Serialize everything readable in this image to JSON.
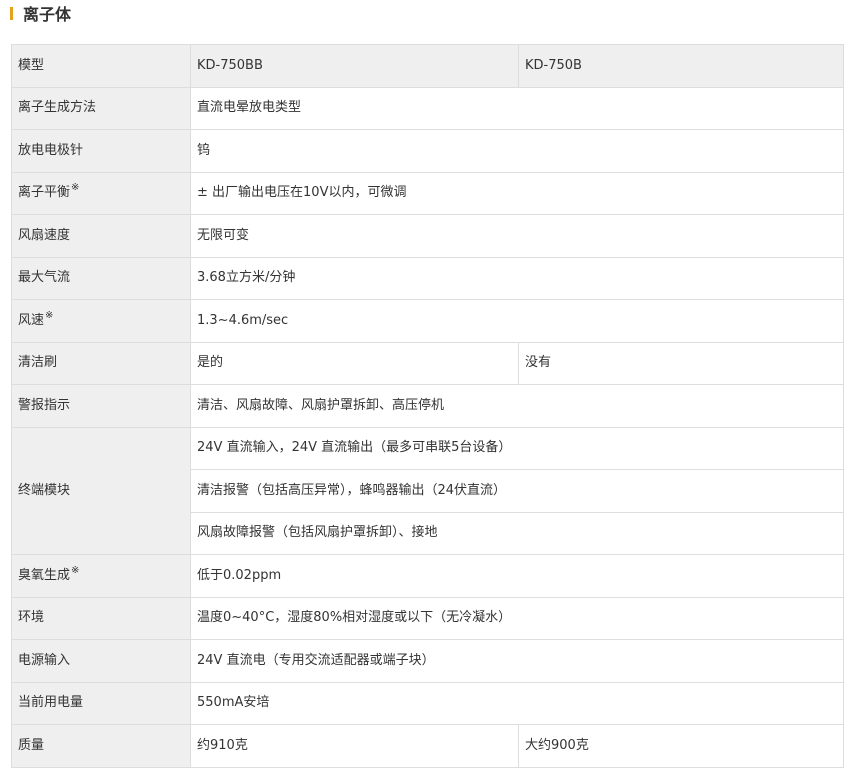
{
  "section": {
    "title": "离子体"
  },
  "spec_table": {
    "header": {
      "label": "模型",
      "model_a": "KD-750BB",
      "model_b": "KD-750B"
    },
    "rows": {
      "ion_method": {
        "label": "离子生成方法",
        "value": "直流电晕放电类型"
      },
      "electrode": {
        "label": "放电电极针",
        "value": "钨"
      },
      "ion_balance": {
        "label": "离子平衡",
        "mark": "※",
        "value": "± 出厂输出电压在10V以内，可微调"
      },
      "fan_speed": {
        "label": "风扇速度",
        "value": "无限可变"
      },
      "max_airflow": {
        "label": "最大气流",
        "value": "3.68立方米/分钟"
      },
      "air_velocity": {
        "label": "风速",
        "mark": "※",
        "value": "1.3~4.6m/sec"
      },
      "cleaning_brush": {
        "label": "清洁刷",
        "value_a": "是的",
        "value_b": "没有"
      },
      "alarm": {
        "label": "警报指示",
        "value": "清洁、风扇故障、风扇护罩拆卸、高压停机"
      },
      "terminal": {
        "label": "终端模块",
        "lines": [
          "24V 直流输入，24V 直流输出（最多可串联5台设备）",
          "清洁报警（包括高压异常），蜂鸣器输出（24伏直流）",
          "风扇故障报警（包括风扇护罩拆卸）、接地"
        ]
      },
      "ozone": {
        "label": "臭氧生成",
        "mark": "※",
        "value": "低于0.02ppm"
      },
      "environment": {
        "label": "环境",
        "value": "温度0~40°C，湿度80%相对湿度或以下（无冷凝水）"
      },
      "power_input": {
        "label": "电源输入",
        "value": "24V 直流电（专用交流适配器或端子块）"
      },
      "current": {
        "label": "当前用电量",
        "value": "550mA安培"
      },
      "mass": {
        "label": "质量",
        "value_a": "约910克",
        "value_b": "大约900克"
      }
    }
  },
  "colors": {
    "accent_bar": "#e8a21a",
    "label_bg": "#efefef",
    "border": "#dddddd",
    "text": "#333333"
  }
}
